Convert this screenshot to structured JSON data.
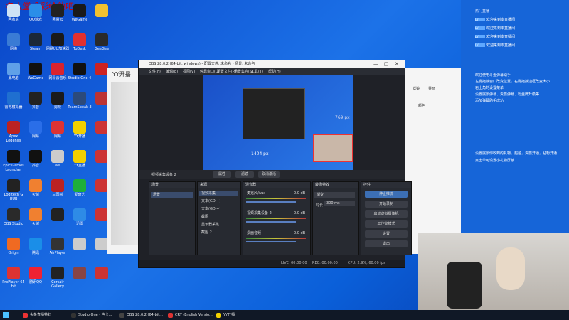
{
  "watermark": "名人堂投彩给他吧",
  "desktop_icons": [
    {
      "label": "回收站",
      "color": "#cfe3f5"
    },
    {
      "label": "QQ游戏",
      "color": "#2a8ee8"
    },
    {
      "label": "网易云",
      "color": "#222"
    },
    {
      "label": "WeGame",
      "color": "#1a1a1a"
    },
    {
      "label": "",
      "color": "#f2c230"
    },
    {
      "label": "网络",
      "color": "#3a7bd5"
    },
    {
      "label": "Steam",
      "color": "#1b2838"
    },
    {
      "label": "网易UU加速器",
      "color": "#1a1a1a"
    },
    {
      "label": "ToDesk",
      "color": "#e23030"
    },
    {
      "label": "GeeGee",
      "color": "#2a2a2a"
    },
    {
      "label": "此电脑",
      "color": "#5fa0e8"
    },
    {
      "label": "WeGame",
      "color": "#111"
    },
    {
      "label": "网易云音乐",
      "color": "#d9232e"
    },
    {
      "label": "Studio One 4",
      "color": "#111"
    },
    {
      "label": "",
      "color": "#c22"
    },
    {
      "label": "雷电模拟器",
      "color": "#1f6fd0"
    },
    {
      "label": "抖音",
      "color": "#222"
    },
    {
      "label": "剪映",
      "color": "#1a1a1a"
    },
    {
      "label": "TeamSpeak 3",
      "color": "#2c4a7a"
    },
    {
      "label": "",
      "color": "#b33"
    },
    {
      "label": "Apex Legends",
      "color": "#b22"
    },
    {
      "label": "网易",
      "color": "#2a6ee8"
    },
    {
      "label": "网易",
      "color": "#d33"
    },
    {
      "label": "YY开播",
      "color": "#f2d000"
    },
    {
      "label": "",
      "color": "#c33"
    },
    {
      "label": "Epic Games Launcher",
      "color": "#111"
    },
    {
      "label": "抖音",
      "color": "#111"
    },
    {
      "label": "ae",
      "color": "#ccc"
    },
    {
      "label": "YY直播",
      "color": "#f2d000"
    },
    {
      "label": "",
      "color": "#c33"
    },
    {
      "label": "Logitech G HUB",
      "color": "#222"
    },
    {
      "label": "火绒",
      "color": "#f08030"
    },
    {
      "label": "三国杀",
      "color": "#b22"
    },
    {
      "label": "爱奇艺",
      "color": "#1eaf3a"
    },
    {
      "label": "",
      "color": "#c33"
    },
    {
      "label": "OBS Studio",
      "color": "#2a2a2a"
    },
    {
      "label": "火绒",
      "color": "#f08030"
    },
    {
      "label": "",
      "color": "#222"
    },
    {
      "label": "迅雷",
      "color": "#2e8be6"
    },
    {
      "label": "",
      "color": "#c33"
    },
    {
      "label": "Origin",
      "color": "#f06a22"
    },
    {
      "label": "腾讯",
      "color": "#1a8ee8"
    },
    {
      "label": "AirPlayer",
      "color": "#333"
    },
    {
      "label": "",
      "color": "#ccc"
    },
    {
      "label": "",
      "color": "#ccc"
    },
    {
      "label": "ProPlayer 64 bit",
      "color": "#d33"
    },
    {
      "label": "腾讯QQ",
      "color": "#e23"
    },
    {
      "label": "Corsair Gallery",
      "color": "#222"
    },
    {
      "label": "",
      "color": "#844"
    },
    {
      "label": "",
      "color": "#c33"
    }
  ],
  "taskbar": [
    {
      "label": "头条直播特效",
      "color": "#e33"
    },
    {
      "label": "Studio One - 声卡...",
      "color": "#333"
    },
    {
      "label": "OBS 28.0.2 (64-bit...",
      "color": "#444"
    },
    {
      "label": "CRY (English Versio...",
      "color": "#d33"
    },
    {
      "label": "YY开播",
      "color": "#f2d000"
    }
  ],
  "yy": {
    "title": "YY开播"
  },
  "obs": {
    "title": "OBS 28.0.2 (64-bit, windows) - 配置文件: 未命名 - 场景: 未命名",
    "menu": [
      "文件(F)",
      "编辑(E)",
      "视图(V)",
      "停靠窗口(D)",
      "配置文件(P)",
      "场景集合(S)",
      "工具(T)",
      "帮助(H)"
    ],
    "preview_num": "769 px",
    "preview_num2": "1404 px",
    "source_bar": {
      "label": "视频采集设备 2",
      "btn1": "属性",
      "btn2": "滤镜",
      "btn3": "取消激活"
    },
    "docks": {
      "scenes": {
        "title": "场景",
        "items": [
          "场景"
        ]
      },
      "sources": {
        "title": "来源",
        "items": [
          "视频采集",
          "文本(GDI+)",
          "文本(GDI+)",
          "截图",
          "显示器采集",
          "截图 2"
        ]
      },
      "mixer": {
        "title": "混音器",
        "channels": [
          {
            "name": "麦克风/Aux",
            "db": "0.0 dB"
          },
          {
            "name": "视频采集设备 2",
            "db": "0.0 dB"
          },
          {
            "name": "桌面音频",
            "db": "0.0 dB"
          }
        ]
      },
      "transitions": {
        "title": "转场特效",
        "mode": "渐变",
        "duration_label": "时长",
        "duration": "300 ms"
      },
      "controls": {
        "title": "控件",
        "buttons": [
          "停止推流",
          "开始录制",
          "启动虚拟摄像机",
          "工作室模式",
          "设置",
          "退出"
        ]
      }
    },
    "status": {
      "live": "LIVE: 00:00:00",
      "rec": "REC: 00:00:00",
      "cpu": "CPU: 2.9%, 60.00 fps"
    }
  },
  "right_panel": {
    "header": "热门直播",
    "messages": [
      {
        "tag": "LV",
        "text": "欢迎来到本直播间"
      },
      {
        "tag": "LV",
        "text": "欢迎来到本直播间"
      },
      {
        "tag": "LV",
        "text": "欢迎来到本直播间"
      },
      {
        "tag": "LV",
        "text": "欢迎来到本直播间"
      }
    ],
    "notice": [
      "欢迎使用斗鱼弹幕助手",
      "左键拖拽窗口改变位置，右键拖拽边框改变大小",
      "右上角的设置菜单",
      "设置展示弹幕、贵族弹幕、粉丝牌升级等",
      "添加弹幕助手成功"
    ],
    "notice2": [
      "设置展示你收到的礼物，超越，贵族开通，钻粉开通",
      "点击单可设置小礼物屏蔽"
    ]
  },
  "bgwin": {
    "tabs": [
      "滤镜",
      "界面"
    ],
    "label": "颜色"
  }
}
